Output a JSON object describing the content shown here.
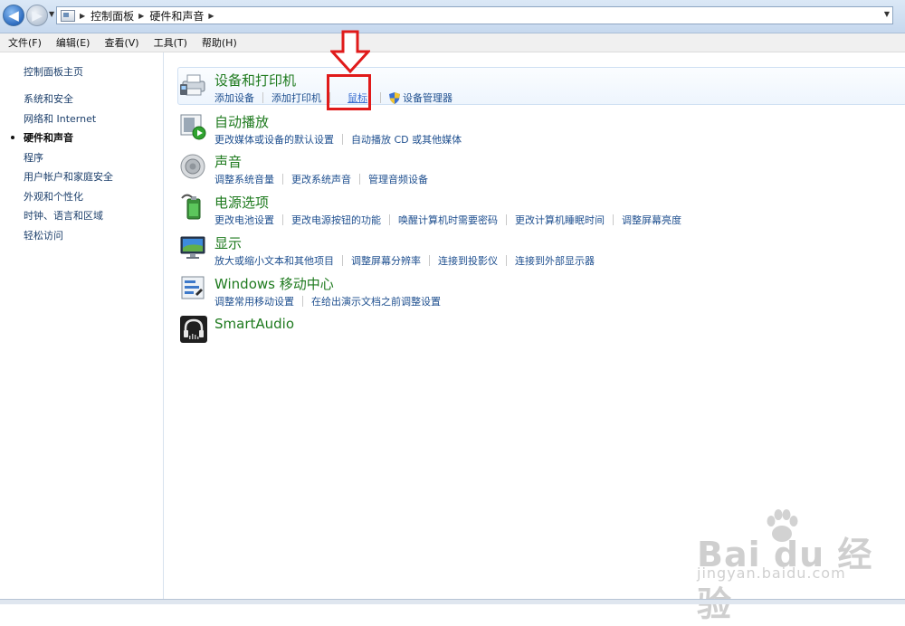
{
  "address": {
    "breadcrumbs": [
      "控制面板",
      "硬件和声音"
    ]
  },
  "menu": [
    "文件(F)",
    "编辑(E)",
    "查看(V)",
    "工具(T)",
    "帮助(H)"
  ],
  "left_pane": {
    "home": "控制面板主页",
    "items": [
      "系统和安全",
      "网络和 Internet",
      "硬件和声音",
      "程序",
      "用户帐户和家庭安全",
      "外观和个性化",
      "时钟、语言和区域",
      "轻松访问"
    ],
    "active_index": 2
  },
  "categories": {
    "devices": {
      "title": "设备和打印机",
      "links": [
        "添加设备",
        "添加打印机",
        "鼠标",
        "设备管理器"
      ]
    },
    "autoplay": {
      "title": "自动播放",
      "links": [
        "更改媒体或设备的默认设置",
        "自动播放 CD 或其他媒体"
      ]
    },
    "sound": {
      "title": "声音",
      "links": [
        "调整系统音量",
        "更改系统声音",
        "管理音频设备"
      ]
    },
    "power": {
      "title": "电源选项",
      "links": [
        "更改电池设置",
        "更改电源按钮的功能",
        "唤醒计算机时需要密码",
        "更改计算机睡眠时间",
        "调整屏幕亮度"
      ]
    },
    "display": {
      "title": "显示",
      "links": [
        "放大或缩小文本和其他项目",
        "调整屏幕分辨率",
        "连接到投影仪",
        "连接到外部显示器"
      ]
    },
    "mobility": {
      "title": "Windows 移动中心",
      "links": [
        "调整常用移动设置",
        "在给出演示文档之前调整设置"
      ]
    },
    "smartaudio": {
      "title": "SmartAudio"
    }
  },
  "watermark": {
    "main": "Bai du 经验",
    "sub": "jingyan.baidu.com"
  },
  "colors": {
    "title_green": "#1e7a1e",
    "link_blue": "#1e4f8f",
    "annotation_red": "#e01a1a"
  }
}
